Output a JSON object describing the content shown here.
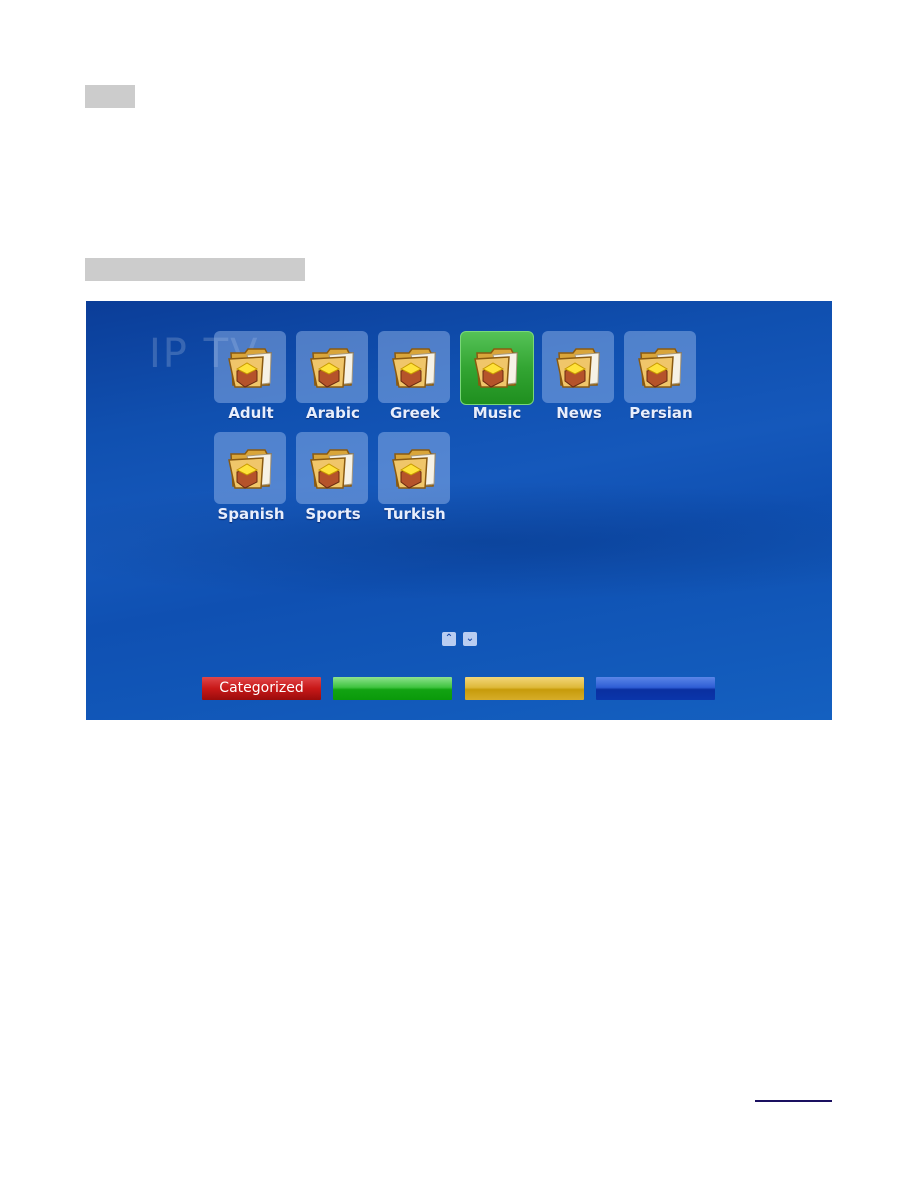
{
  "screen": {
    "watermark_title": "IP TV",
    "categories": [
      {
        "label": "Adult",
        "selected": false
      },
      {
        "label": "Arabic",
        "selected": false
      },
      {
        "label": "Greek",
        "selected": false
      },
      {
        "label": "Music",
        "selected": true
      },
      {
        "label": "News",
        "selected": false
      },
      {
        "label": "Persian",
        "selected": false
      },
      {
        "label": "Spanish",
        "selected": false
      },
      {
        "label": "Sports",
        "selected": false
      },
      {
        "label": "Turkish",
        "selected": false
      }
    ],
    "nav": {
      "up_icon": "chevron-up-icon",
      "down_icon": "chevron-down-icon",
      "up_glyph": "⌃",
      "down_glyph": "⌄"
    },
    "color_buttons": [
      {
        "color": "red",
        "label": "Categorized",
        "hex": "#c81818"
      },
      {
        "color": "green",
        "label": "",
        "hex": "#12a312"
      },
      {
        "color": "yellow",
        "label": "",
        "hex": "#d6ad2a"
      },
      {
        "color": "blue",
        "label": "",
        "hex": "#0a35aa"
      }
    ]
  }
}
